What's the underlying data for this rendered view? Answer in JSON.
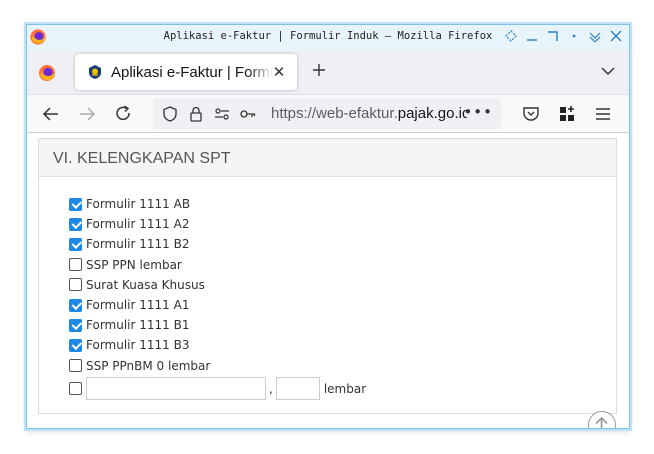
{
  "window": {
    "title": "Aplikasi e-Faktur | Formulir Induk — Mozilla Firefox"
  },
  "tab": {
    "title": "Aplikasi e-Faktur | Formulir Induk"
  },
  "url": {
    "prefix": "https://web-efaktur.",
    "domain": "pajak.go.id"
  },
  "section": {
    "heading": "VI. KELENGKAPAN SPT",
    "items": [
      {
        "label": "Formulir 1111 AB",
        "checked": true
      },
      {
        "label": "Formulir 1111 A2",
        "checked": true
      },
      {
        "label": "Formulir 1111 B2",
        "checked": true
      },
      {
        "label": "SSP PPN lembar",
        "checked": false
      },
      {
        "label": "Surat Kuasa Khusus",
        "checked": false
      },
      {
        "label": "Formulir 1111 A1",
        "checked": true
      },
      {
        "label": "Formulir 1111 B1",
        "checked": true
      },
      {
        "label": "Formulir 1111 B3",
        "checked": true
      },
      {
        "label": "SSP PPnBM 0 lembar",
        "checked": false
      }
    ],
    "other": {
      "checked": false,
      "name_value": "",
      "count_value": "",
      "comma": ",",
      "unit": "lembar"
    }
  },
  "colors": {
    "checkbox_accent": "#1e88e5",
    "window_border": "#7ec3e6"
  }
}
